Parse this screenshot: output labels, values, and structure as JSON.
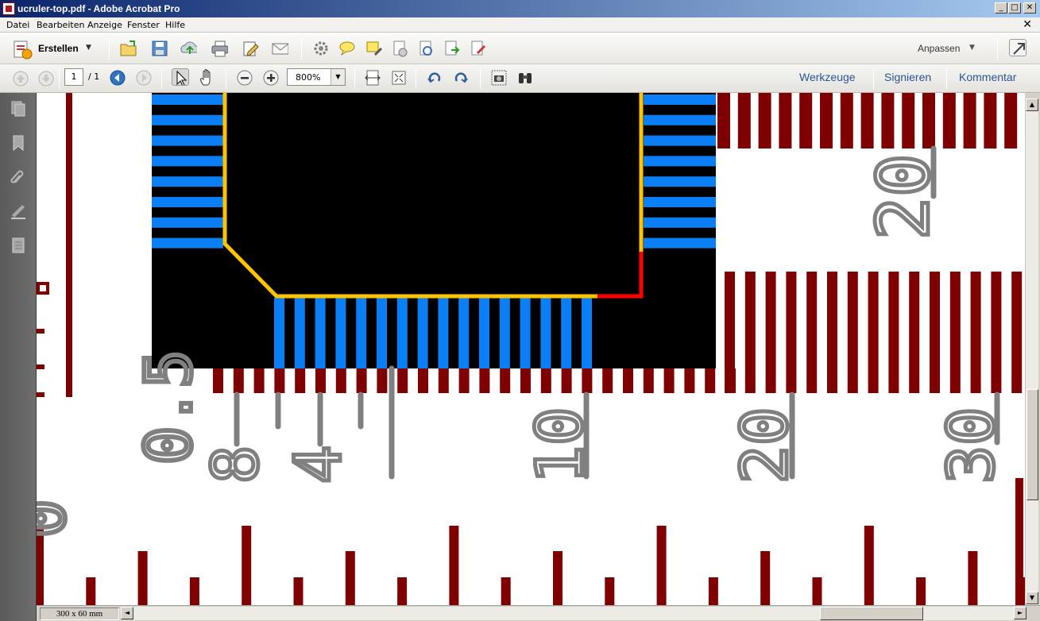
{
  "window": {
    "title": "ucruler-top.pdf - Adobe Acrobat Pro",
    "minimize_glyph": "_",
    "maximize_glyph": "□",
    "close_glyph": "✕"
  },
  "menu": {
    "items": [
      "Datei",
      "Bearbeiten",
      "Anzeige",
      "Fenster",
      "Hilfe"
    ],
    "doc_close_glyph": "✕"
  },
  "toolbar": {
    "create_label": "Erstellen",
    "caret_glyph": "▼",
    "customize_label": "Anpassen",
    "icons": [
      "open-icon",
      "save-icon",
      "upload-icon",
      "print-icon",
      "edit-icon",
      "email-icon",
      "settings-icon",
      "comment-icon",
      "highlight-icon",
      "delete-page-icon",
      "rotate-icon",
      "export-icon",
      "sign-icon",
      "fullscreen-icon"
    ]
  },
  "navigation": {
    "current_page": "1",
    "total_pages": "/ 1",
    "zoom": "800%"
  },
  "panels": {
    "tools": "Werkzeuge",
    "sign": "Signieren",
    "comment": "Kommentar"
  },
  "status": {
    "page_size": "300 x 60 mm"
  },
  "drawing": {
    "labels": {
      "top_right": "20",
      "ruler_08": "8",
      "ruler_04": "4",
      "ruler_10": "10",
      "ruler_20": "20",
      "ruler_30": "30",
      "left_05": "0.5",
      "left_0": "0"
    },
    "colors": {
      "pad": "#0a7ff5",
      "outline": "#ffc400",
      "trace": "#ff0000",
      "ruler": "#7f0000",
      "silk": "#808080",
      "board": "#000000"
    }
  },
  "scroll": {
    "up": "▲",
    "down": "▼",
    "left": "◄",
    "right": "►"
  }
}
